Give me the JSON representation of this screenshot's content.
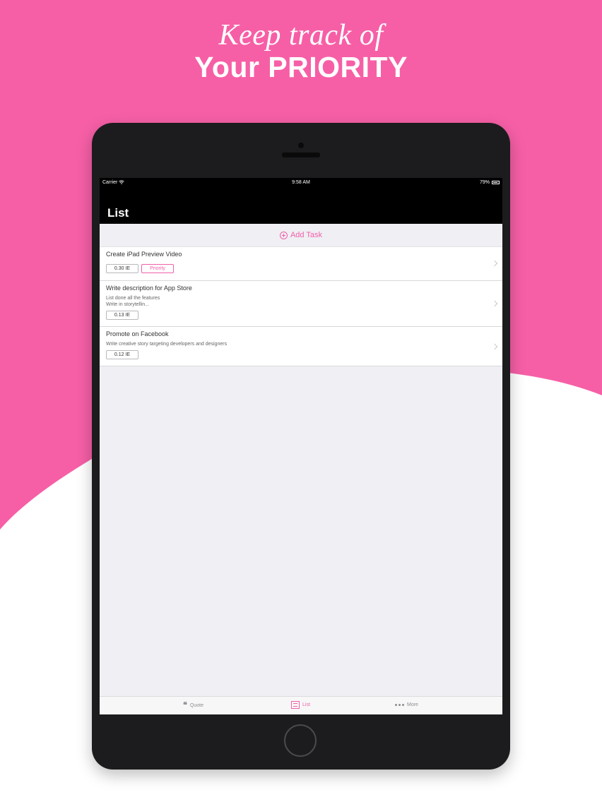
{
  "marketing": {
    "line1": "Keep track of",
    "line2": "Your PRIORITY",
    "background_color": "#f65fa6"
  },
  "status_bar": {
    "carrier": "Carrier",
    "time": "9:58 AM",
    "battery": "79%"
  },
  "nav": {
    "title": "List"
  },
  "add_task": {
    "label": "Add Task"
  },
  "tasks": [
    {
      "title": "Create iPad Preview Video",
      "note1": "",
      "note2": "",
      "score": "0.30 IE",
      "badge": "Priority"
    },
    {
      "title": "Write description for App Store",
      "note1": "List done all the features",
      "note2": "Write in storytellin...",
      "score": "0.13 IE",
      "badge": ""
    },
    {
      "title": "Promote on Facebook",
      "note1": "Write creative story targeting developers and designers",
      "note2": "",
      "score": "0.12 IE",
      "badge": ""
    }
  ],
  "tabs": [
    {
      "label": "Quote",
      "icon": "quote-icon"
    },
    {
      "label": "List",
      "icon": "list-icon"
    },
    {
      "label": "More",
      "icon": "more-icon"
    }
  ],
  "colors": {
    "accent": "#f25fa8",
    "device": "#1c1c1e"
  }
}
